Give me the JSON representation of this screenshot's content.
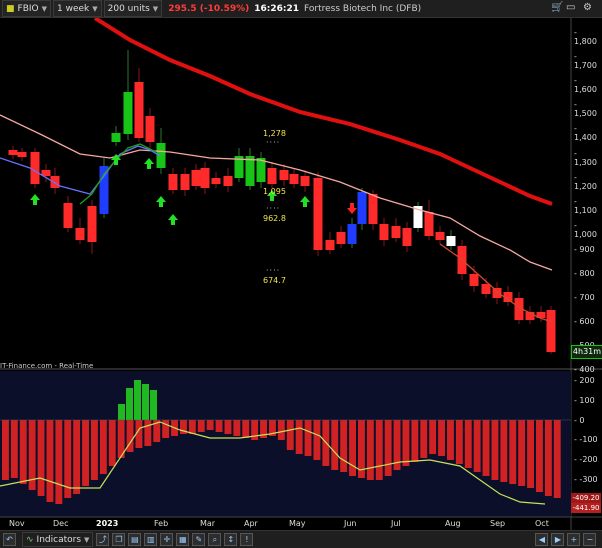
{
  "toolbar": {
    "symbol": "FBIO",
    "period": "1 week",
    "volume": "200 units",
    "price_change": "295.5 (-10.59%)",
    "time": "16:26:21",
    "company": "Fortress Biotech Inc (DFB)"
  },
  "price_axis": {
    "ticks": [
      "1,800",
      "1,700",
      "1,600",
      "1,500",
      "1,400",
      "1,300",
      "1,200",
      "1,100",
      "1,000",
      "900",
      "800",
      "700",
      "600",
      "500",
      "400"
    ],
    "countdown": "4h31m"
  },
  "indicator_axis": {
    "ticks": [
      "200",
      "100",
      "0",
      "-100",
      "-200",
      "-300",
      "-400"
    ],
    "last_values": [
      "-409.20",
      "-441.90"
    ]
  },
  "source_label": "IT-Finance.com - Real-Time",
  "annotations": [
    "1,278",
    "1,095",
    "962.8",
    "674.7"
  ],
  "x_axis": [
    "Nov",
    "Dec",
    "2023",
    "Feb",
    "Mar",
    "Apr",
    "May",
    "Jun",
    "Jul",
    "Aug",
    "Sep",
    "Oct"
  ],
  "bottom_bar": {
    "indicators_label": "Indicators"
  },
  "colors": {
    "up": "#19c419",
    "down": "#ff2a2a",
    "blue": "#1f3cff",
    "white": "#ffffff",
    "ma_long": "#e01010",
    "ma_short": "#f4a9a0"
  }
}
